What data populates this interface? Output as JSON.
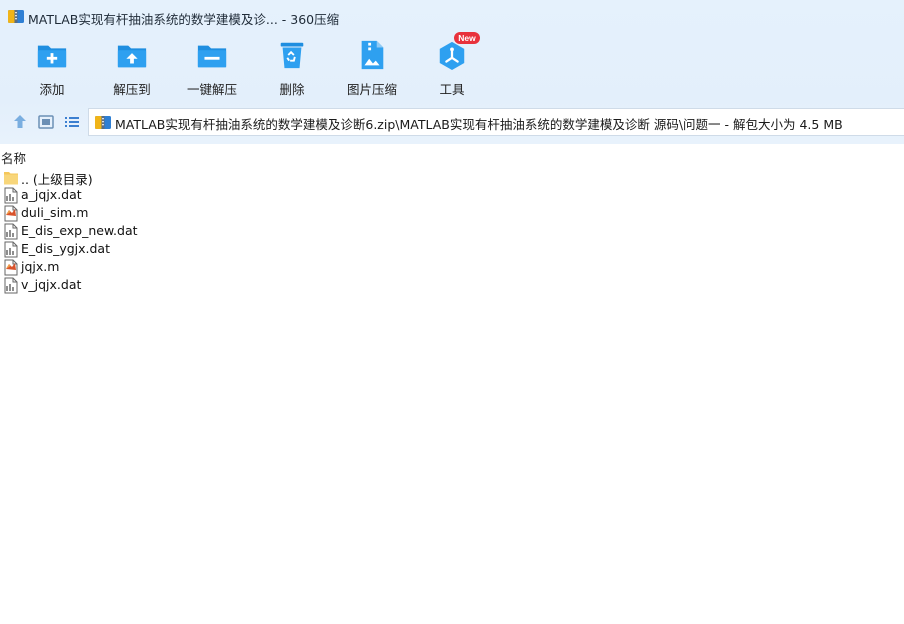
{
  "window": {
    "title": "MATLAB实现有杆抽油系统的数学建模及诊... - 360压缩"
  },
  "toolbar": {
    "items": [
      {
        "label": "添加",
        "icon": "add-folder-icon"
      },
      {
        "label": "解压到",
        "icon": "extract-to-icon"
      },
      {
        "label": "一键解压",
        "icon": "one-click-extract-icon"
      },
      {
        "label": "删除",
        "icon": "recycle-bin-icon"
      },
      {
        "label": "图片压缩",
        "icon": "image-compress-icon"
      },
      {
        "label": "工具",
        "icon": "tools-icon",
        "badge": "New"
      }
    ]
  },
  "address_bar": {
    "path": "MATLAB实现有杆抽油系统的数学建模及诊断6.zip\\MATLAB实现有杆抽油系统的数学建模及诊断 源码\\问题一 - 解包大小为 4.5 MB"
  },
  "file_list": {
    "column_header": "名称",
    "rows": [
      {
        "name": ".. (上级目录)",
        "type": "folder"
      },
      {
        "name": "a_jqjx.dat",
        "type": "dat"
      },
      {
        "name": "duli_sim.m",
        "type": "m"
      },
      {
        "name": "E_dis_exp_new.dat",
        "type": "dat"
      },
      {
        "name": "E_dis_ygjx.dat",
        "type": "dat"
      },
      {
        "name": "jqjx.m",
        "type": "m"
      },
      {
        "name": "v_jqjx.dat",
        "type": "dat"
      }
    ]
  },
  "colors": {
    "accent_blue": "#1f8ee0",
    "badge_red": "#e8323c",
    "toolbar_bg": "#e4f0fb"
  }
}
